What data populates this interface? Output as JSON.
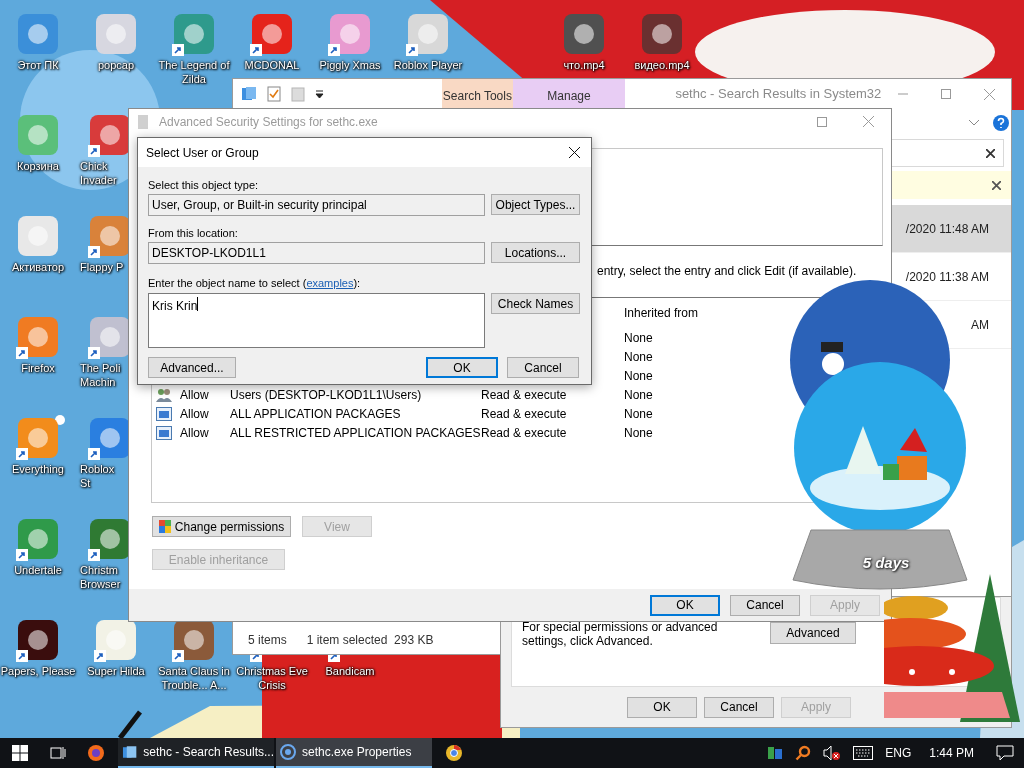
{
  "desktop": {
    "icons": [
      {
        "label": "Этот ПК",
        "shortcut": false
      },
      {
        "label": "Корзина",
        "shortcut": false
      },
      {
        "label": "Активатор",
        "shortcut": false
      },
      {
        "label": "Firefox",
        "shortcut": true
      },
      {
        "label": "Everything",
        "shortcut": true
      },
      {
        "label": "Undertale",
        "shortcut": true
      },
      {
        "label": "Papers, Please",
        "shortcut": true
      },
      {
        "label": "popcap",
        "shortcut": false
      },
      {
        "label": "Chick Invader",
        "shortcut": true
      },
      {
        "label": "Flappy P",
        "shortcut": true
      },
      {
        "label": "The Poli Machin",
        "shortcut": true
      },
      {
        "label": "Roblox St",
        "shortcut": true
      },
      {
        "label": "Christm Browser",
        "shortcut": true
      },
      {
        "label": "Super Hilda",
        "shortcut": true
      },
      {
        "label": "The Legend of Zilda",
        "shortcut": true
      },
      {
        "label": "MCDONAL",
        "shortcut": true
      },
      {
        "label": "Piggly Xmas",
        "shortcut": true
      },
      {
        "label": "Roblox Player",
        "shortcut": true
      },
      {
        "label": "Santa Claus in Trouble... A...",
        "shortcut": true
      },
      {
        "label": "Christmas Eve Crisis",
        "shortcut": true
      },
      {
        "label": "Bandicam",
        "shortcut": true
      },
      {
        "label": "что.mp4",
        "shortcut": false
      },
      {
        "label": "видео.mp4",
        "shortcut": false
      }
    ]
  },
  "explorer": {
    "title": "sethc - Search Results in System32",
    "context_tabs": [
      {
        "label": "Search Tools",
        "color": "#f9d9c4"
      },
      {
        "label": "Manage",
        "color": "#e8cdf4"
      }
    ],
    "files": [
      {
        "modified": "/2020 11:48 AM",
        "selected": true
      },
      {
        "modified": "/2020 11:38 AM",
        "selected": false
      },
      {
        "modified": "AM",
        "selected": false
      }
    ],
    "status": {
      "count": "5 items",
      "selection": "1 item selected  293 KB"
    }
  },
  "properties": {
    "note": "For special permissions or advanced settings, click Advanced.",
    "advanced_button": "Advanced",
    "buttons": [
      {
        "label": "OK",
        "disabled": false
      },
      {
        "label": "Cancel",
        "disabled": false
      },
      {
        "label": "Apply",
        "disabled": true
      }
    ]
  },
  "advanced_security": {
    "title": "Advanced Security Settings for sethc.exe",
    "instruction": "entry, select the entry and click Edit (if available).",
    "column": "Inherited from",
    "rows": [
      {
        "inherited": "None"
      },
      {
        "inherited": "None"
      },
      {
        "inherited": "None"
      },
      {
        "kind": "users",
        "type": "Allow",
        "principal": "Users (DESKTOP-LKOD1L1\\Users)",
        "access": "Read & execute",
        "inherited": "None"
      },
      {
        "kind": "package",
        "type": "Allow",
        "principal": "ALL APPLICATION PACKAGES",
        "access": "Read & execute",
        "inherited": "None"
      },
      {
        "kind": "package",
        "type": "Allow",
        "principal": "ALL RESTRICTED APPLICATION PACKAGES",
        "access": "Read & execute",
        "inherited": "None"
      }
    ],
    "actions": [
      {
        "label": "Change permissions",
        "disabled": false
      },
      {
        "label": "View",
        "disabled": true
      }
    ],
    "inheritance": {
      "label": "Enable inheritance",
      "disabled": true
    },
    "buttons": [
      {
        "label": "OK",
        "default": true,
        "disabled": false
      },
      {
        "label": "Cancel",
        "default": false,
        "disabled": false
      },
      {
        "label": "Apply",
        "default": false,
        "disabled": true
      }
    ]
  },
  "select_dialog": {
    "title": "Select User or Group",
    "object_type": {
      "label": "Select this object type:",
      "value": "User, Group, or Built-in security principal",
      "button": "Object Types..."
    },
    "location": {
      "label": "From this location:",
      "value": "DESKTOP-LKOD1L1",
      "button": "Locations..."
    },
    "prompt": {
      "before": "Enter the object name to select (",
      "link": "examples",
      "after": "):"
    },
    "names": {
      "value": "Kris Krin",
      "button": "Check Names"
    },
    "buttons": [
      {
        "label": "Advanced...",
        "default": false
      },
      {
        "label": "OK",
        "default": true
      },
      {
        "label": "Cancel",
        "default": false
      }
    ]
  },
  "gadget": {
    "caption": "5 days"
  },
  "taskbar": {
    "apps": [
      {
        "label": "sethc - Search Results...",
        "selected": false
      },
      {
        "label": "sethc.exe Properties",
        "selected": true
      }
    ],
    "language": "ENG",
    "time": "1:44 PM"
  }
}
